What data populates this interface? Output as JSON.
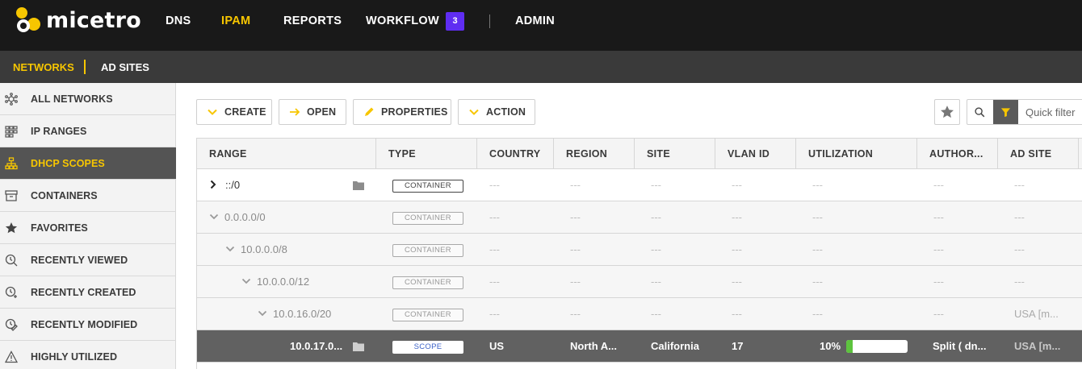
{
  "app": {
    "name": "micetro"
  },
  "nav": {
    "items": [
      {
        "label": "DNS",
        "active": false
      },
      {
        "label": "IPAM",
        "active": true
      },
      {
        "label": "REPORTS",
        "active": false
      },
      {
        "label": "WORKFLOW",
        "active": false
      },
      {
        "label": "ADMIN",
        "active": false
      }
    ],
    "workflow_badge": "3"
  },
  "subnav": {
    "items": [
      {
        "label": "NETWORKS",
        "active": true
      },
      {
        "label": "AD SITES",
        "active": false
      }
    ]
  },
  "sidebar": {
    "items": [
      {
        "label": "ALL NETWORKS",
        "icon": "network-icon",
        "active": false
      },
      {
        "label": "IP RANGES",
        "icon": "ip-ranges-icon",
        "active": false
      },
      {
        "label": "DHCP SCOPES",
        "icon": "dhcp-scopes-icon",
        "active": true
      },
      {
        "label": "CONTAINERS",
        "icon": "container-icon",
        "active": false
      },
      {
        "label": "FAVORITES",
        "icon": "star-icon",
        "active": false
      },
      {
        "label": "RECENTLY VIEWED",
        "icon": "recently-viewed-icon",
        "active": false
      },
      {
        "label": "RECENTLY CREATED",
        "icon": "recently-created-icon",
        "active": false
      },
      {
        "label": "RECENTLY MODIFIED",
        "icon": "recently-modified-icon",
        "active": false
      },
      {
        "label": "HIGHLY UTILIZED",
        "icon": "warning-icon",
        "active": false
      }
    ]
  },
  "toolbar": {
    "create": "CREATE",
    "open": "OPEN",
    "properties": "PROPERTIES",
    "action": "ACTION",
    "quick_filter_placeholder": "Quick filter"
  },
  "table": {
    "columns": [
      "RANGE",
      "TYPE",
      "COUNTRY",
      "REGION",
      "SITE",
      "VLAN ID",
      "UTILIZATION",
      "AUTHOR...",
      "AD SITE"
    ],
    "rows": [
      {
        "range": "::/0",
        "type": "CONTAINER",
        "country": "---",
        "region": "---",
        "site": "---",
        "vlan": "---",
        "utilization": "---",
        "author": "---",
        "adsite": "---"
      },
      {
        "range": "0.0.0.0/0",
        "type": "CONTAINER",
        "country": "---",
        "region": "---",
        "site": "---",
        "vlan": "---",
        "utilization": "---",
        "author": "---",
        "adsite": "---"
      },
      {
        "range": "10.0.0.0/8",
        "type": "CONTAINER",
        "country": "---",
        "region": "---",
        "site": "---",
        "vlan": "---",
        "utilization": "---",
        "author": "---",
        "adsite": "---"
      },
      {
        "range": "10.0.0.0/12",
        "type": "CONTAINER",
        "country": "---",
        "region": "---",
        "site": "---",
        "vlan": "---",
        "utilization": "---",
        "author": "---",
        "adsite": "---"
      },
      {
        "range": "10.0.16.0/20",
        "type": "CONTAINER",
        "country": "---",
        "region": "---",
        "site": "---",
        "vlan": "---",
        "utilization": "---",
        "author": "---",
        "adsite": "USA [m..."
      },
      {
        "range": "10.0.17.0...",
        "type": "SCOPE",
        "country": "US",
        "region": "North A...",
        "site": "California",
        "vlan": "17",
        "utilization": "10%",
        "utilization_fraction": 0.1,
        "author": "Split ( dn...",
        "adsite": "USA [m..."
      }
    ]
  },
  "colors": {
    "accent": "#f7c600",
    "badge": "#5f2df2",
    "utilization_fill": "#5dc33e",
    "selected_row": "#616161"
  }
}
